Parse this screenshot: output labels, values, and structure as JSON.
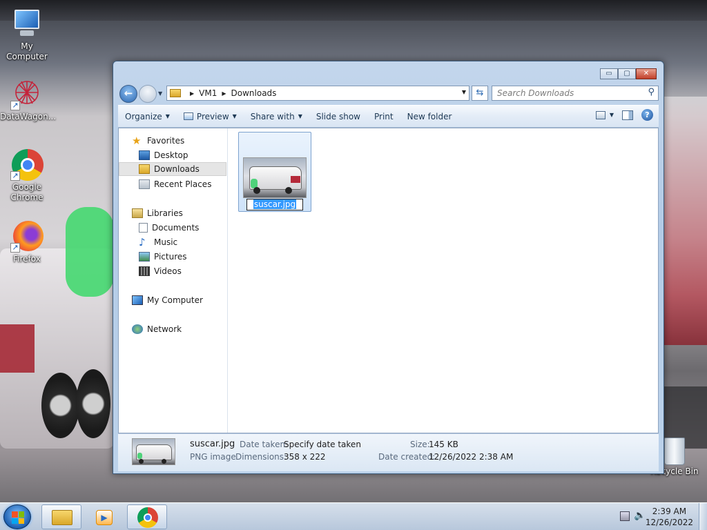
{
  "desktop": {
    "icons": [
      {
        "label": "My Computer"
      },
      {
        "label": "DataWagon..."
      },
      {
        "label": "Google Chrome"
      },
      {
        "label": "Firefox"
      },
      {
        "label": "Recycle Bin"
      }
    ]
  },
  "window": {
    "caption_buttons": {
      "minimize": "▭",
      "maximize": "▢",
      "close": "✕"
    },
    "breadcrumb": [
      "VM1",
      "Downloads"
    ],
    "search_placeholder": "Search Downloads",
    "toolbar": {
      "organize": "Organize",
      "preview": "Preview",
      "share_with": "Share with",
      "slide_show": "Slide show",
      "print": "Print",
      "new_folder": "New folder"
    },
    "nav": {
      "favorites": "Favorites",
      "desktop": "Desktop",
      "downloads": "Downloads",
      "recent_places": "Recent Places",
      "libraries": "Libraries",
      "documents": "Documents",
      "music": "Music",
      "pictures": "Pictures",
      "videos": "Videos",
      "my_computer": "My Computer",
      "network": "Network"
    },
    "file": {
      "name": "suscar.jpg"
    },
    "details": {
      "name": "suscar.jpg",
      "type": "PNG image",
      "date_taken_label": "Date taken:",
      "date_taken_value": "Specify date taken",
      "dimensions_label": "Dimensions:",
      "dimensions_value": "358 x 222",
      "size_label": "Size:",
      "size_value": "145 KB",
      "date_created_label": "Date created:",
      "date_created_value": "12/26/2022 2:38 AM"
    }
  },
  "taskbar": {
    "time": "2:39 AM",
    "date": "12/26/2022",
    "start_colors": [
      "#f35325",
      "#81bc06",
      "#05a6f0",
      "#ffba08"
    ]
  }
}
